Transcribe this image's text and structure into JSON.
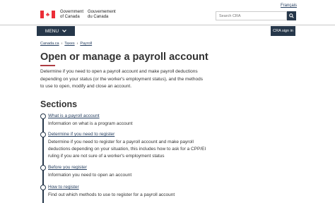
{
  "header": {
    "language_toggle": "Français",
    "gov_en_line1": "Government",
    "gov_en_line2": "of Canada",
    "gov_fr_line1": "Gouvernement",
    "gov_fr_line2": "du Canada",
    "search_placeholder": "Search CRA",
    "colors": {
      "flag_red": "#eb2d37",
      "nav_dark": "#26374a"
    }
  },
  "nav": {
    "menu_label": "MENU",
    "signin_label": "CRA sign in"
  },
  "breadcrumb": [
    "Canada.ca",
    "Taxes",
    "Payroll"
  ],
  "main": {
    "title": "Open or manage a payroll account",
    "intro": "Determine if you need to open a payroll account and make payroll deductions depending on your status (or the worker's employment status), and the methods to use to open, modify and close an account.",
    "sections_heading": "Sections",
    "sections": [
      {
        "link": "What is a payroll account",
        "desc": "Information on what is a program account"
      },
      {
        "link": "Determine if you need to register",
        "desc": "Determine if you need to register for a payroll account and make payroll deductions depending on your situation, this includes how to ask for a CPP/EI ruling if you are not sure of a worker's employment status"
      },
      {
        "link": "Before you register",
        "desc": "Information you need to open an account"
      },
      {
        "link": "How to register",
        "desc": "Find out which methods to use to register for a payroll account"
      }
    ]
  }
}
